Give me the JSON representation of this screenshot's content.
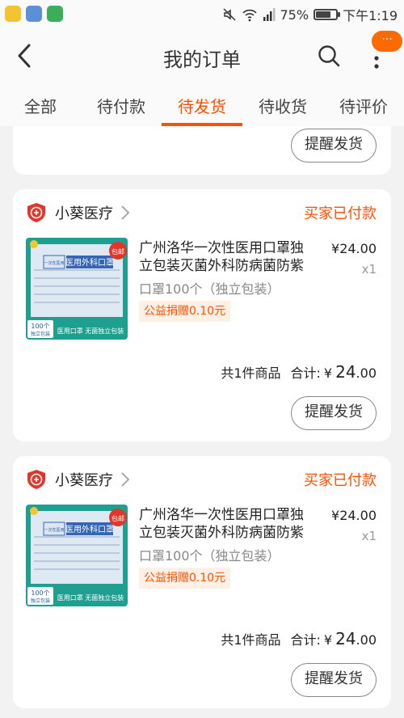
{
  "status_bar": {
    "battery": "75%",
    "battery_level": 0.75,
    "time": "下午1:19"
  },
  "header": {
    "title": "我的订单",
    "badge": "···"
  },
  "tabs": [
    {
      "label": "全部",
      "active": false
    },
    {
      "label": "待付款",
      "active": false
    },
    {
      "label": "待发货",
      "active": true
    },
    {
      "label": "待收货",
      "active": false
    },
    {
      "label": "待评价",
      "active": false
    }
  ],
  "remind_label": "提醒发货",
  "orders": [
    {
      "shop_name": "小葵医疗",
      "status": "买家已付款",
      "title": "广州洛华一次性医用口罩独立包装灭菌外科防病菌防紫外...",
      "price": "¥24.00",
      "qty": "x1",
      "spec": "口罩100个（独立包装）",
      "donation": "公益捐赠0.10元",
      "count_text": "共1件商品",
      "total_label": "合计:",
      "total_currency": "¥",
      "total_int": "24",
      "total_dec": ".00"
    },
    {
      "shop_name": "小葵医疗",
      "status": "买家已付款",
      "title": "广州洛华一次性医用口罩独立包装灭菌外科防病菌防紫外...",
      "price": "¥24.00",
      "qty": "x1",
      "spec": "口罩100个（独立包装）",
      "donation": "公益捐赠0.10元",
      "count_text": "共1件商品",
      "total_label": "合计:",
      "total_currency": "¥",
      "total_int": "24",
      "total_dec": ".00"
    }
  ],
  "product_image": {
    "box_label": "医用外科口罩",
    "box_side": "一次性医用",
    "badge": "包邮",
    "count": "100个",
    "count_sub": "独立包装",
    "caption": "医用口罩 无菌独立包装"
  },
  "colors": {
    "accent": "#ff5000",
    "shop_icon": "#e0372b"
  }
}
